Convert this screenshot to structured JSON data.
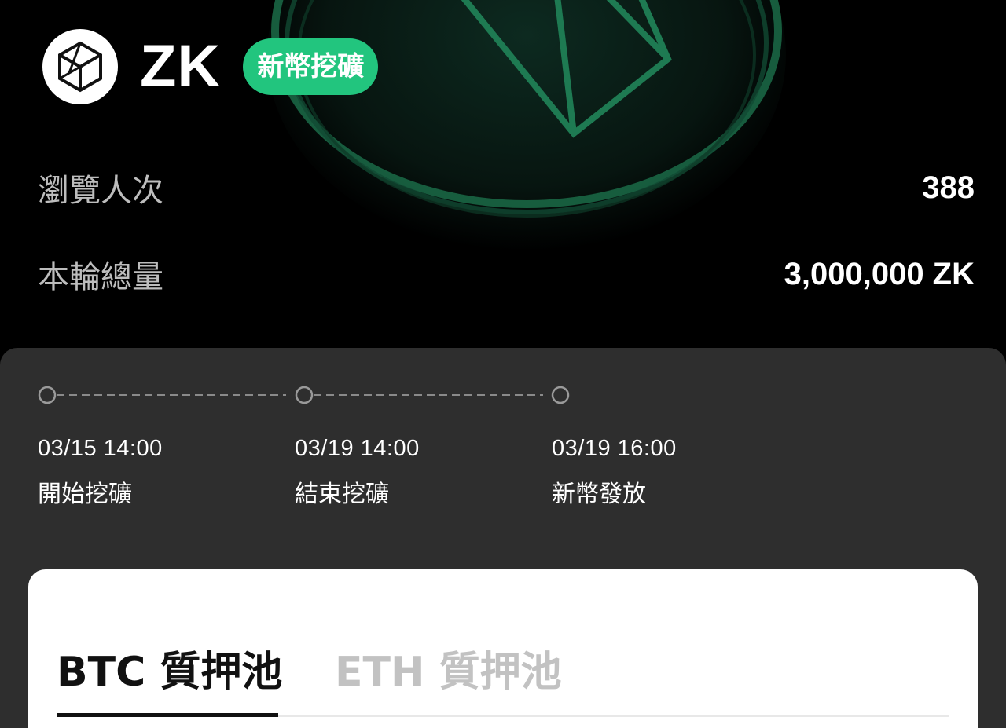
{
  "header": {
    "logo_icon": "zk-cube-logo-icon",
    "token_name": "ZK",
    "badge_label": "新幣挖礦",
    "badge_color": "#22c57e"
  },
  "stats": {
    "views_label": "瀏覽人次",
    "views_value": "388",
    "total_label": "本輪總量",
    "total_value": "3,000,000 ZK"
  },
  "timeline": {
    "milestones": [
      {
        "time": "03/15 14:00",
        "label": "開始挖礦"
      },
      {
        "time": "03/19 14:00",
        "label": "結束挖礦"
      },
      {
        "time": "03/19 16:00",
        "label": "新幣發放"
      }
    ]
  },
  "pool_tabs": {
    "active": "BTC 質押池",
    "inactive": "ETH 質押池"
  }
}
